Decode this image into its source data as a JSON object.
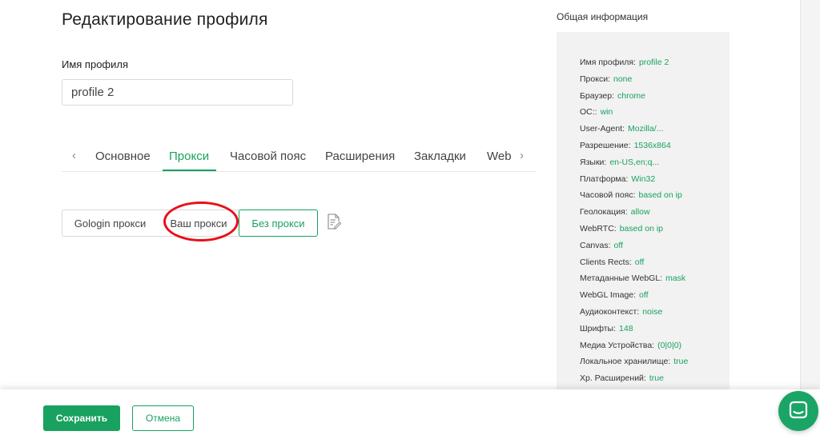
{
  "page": {
    "title": "Редактирование профиля"
  },
  "profile_name": {
    "label": "Имя профиля",
    "value": "profile 2"
  },
  "tabs": {
    "prev_arrow": "‹",
    "next_arrow": "›",
    "items": [
      {
        "label": "Основное"
      },
      {
        "label": "Прокси",
        "active": true
      },
      {
        "label": "Часовой пояс"
      },
      {
        "label": "Расширения"
      },
      {
        "label": "Закладки"
      },
      {
        "label": "Web"
      }
    ]
  },
  "proxy_options": [
    {
      "label": "Gologin прокси"
    },
    {
      "label": "Ваш прокси",
      "highlighted": true
    },
    {
      "label": "Без прокси",
      "selected": true
    }
  ],
  "info_panel": {
    "title": "Общая информация",
    "rows": [
      {
        "key": "Имя профиля:",
        "value": "profile 2"
      },
      {
        "key": "Прокси:",
        "value": "none"
      },
      {
        "key": "Браузер:",
        "value": "chrome"
      },
      {
        "key": "ОС::",
        "value": "win"
      },
      {
        "key": "User-Agent:",
        "value": "Mozilla/..."
      },
      {
        "key": "Разрешение:",
        "value": "1536x864"
      },
      {
        "key": "Языки:",
        "value": "en-US,en;q..."
      },
      {
        "key": "Платформа:",
        "value": "Win32"
      },
      {
        "key": "Часовой пояс:",
        "value": "based on ip"
      },
      {
        "key": "Геолокация:",
        "value": "allow"
      },
      {
        "key": "WebRTC:",
        "value": "based on ip"
      },
      {
        "key": "Canvas:",
        "value": "off"
      },
      {
        "key": "Clients Rects:",
        "value": "off"
      },
      {
        "key": "Метаданные WebGL:",
        "value": "mask"
      },
      {
        "key": "WebGL Image:",
        "value": "off"
      },
      {
        "key": "Аудиоконтекст:",
        "value": "noise"
      },
      {
        "key": "Шрифты:",
        "value": "148"
      },
      {
        "key": "Медиа Устройства:",
        "value": "(0|0|0)"
      },
      {
        "key": "Локальное хранилище:",
        "value": "true"
      },
      {
        "key": "Хр. Расширений:",
        "value": "true"
      }
    ]
  },
  "footer": {
    "save_label": "Сохранить",
    "cancel_label": "Отмена"
  },
  "colors": {
    "accent": "#19a15f",
    "highlight_circle": "#e8101a",
    "panel_bg": "#f2f2f2"
  },
  "icons": {
    "note": "notes-icon",
    "chat": "chat-icon"
  }
}
